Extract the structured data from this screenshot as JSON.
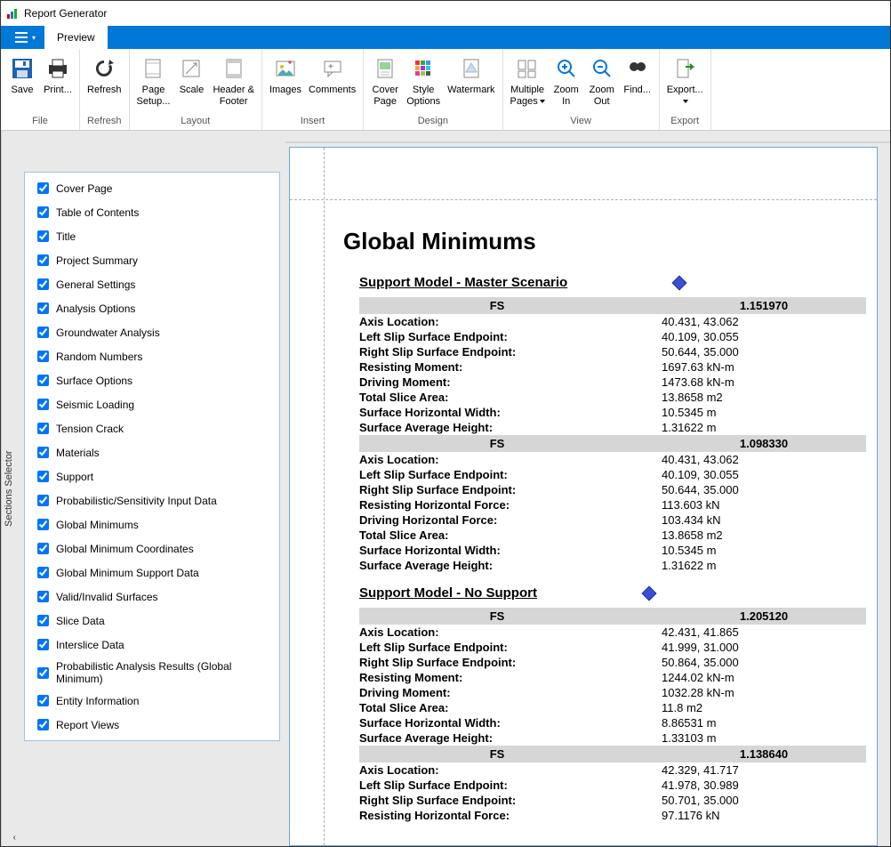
{
  "window": {
    "title": "Report Generator"
  },
  "tabs": {
    "preview": "Preview"
  },
  "ribbon": {
    "file": {
      "save": "Save",
      "print": "Print...",
      "group": "File"
    },
    "refresh": {
      "refresh": "Refresh",
      "group": "Refresh"
    },
    "layout": {
      "page_setup": "Page\nSetup...",
      "scale": "Scale",
      "header_footer": "Header &\nFooter",
      "group": "Layout"
    },
    "insert": {
      "images": "Images",
      "comments": "Comments",
      "group": "Insert"
    },
    "design": {
      "cover_page": "Cover\nPage",
      "style_options": "Style\nOptions",
      "watermark": "Watermark",
      "group": "Design"
    },
    "view": {
      "multiple_pages": "Multiple\nPages",
      "zoom_in": "Zoom\nIn",
      "zoom_out": "Zoom\nOut",
      "find": "Find...",
      "group": "View"
    },
    "export": {
      "export": "Export...",
      "group": "Export"
    }
  },
  "sidebar": {
    "title": "Sections Selector",
    "items": [
      "Cover Page",
      "Table of Contents",
      "Title",
      "Project Summary",
      "General Settings",
      "Analysis Options",
      "Groundwater Analysis",
      "Random Numbers",
      "Surface Options",
      "Seismic Loading",
      "Tension Crack",
      "Materials",
      "Support",
      "Probabilistic/Sensitivity Input Data",
      "Global Minimums",
      "Global Minimum Coordinates",
      "Global Minimum Support Data",
      "Valid/Invalid Surfaces",
      "Slice Data",
      "Interslice Data",
      "Probabilistic Analysis Results (Global Minimum)",
      "Entity Information",
      "Report Views"
    ]
  },
  "doc": {
    "heading": "Global Minimums",
    "section_a": "Support Model - Master Scenario",
    "section_b": "Support Model - No Support",
    "fs_label": "FS",
    "fs_values": [
      "1.151970",
      "1.098330",
      "1.205120",
      "1.138640"
    ],
    "labels": {
      "axis": "Axis Location:",
      "left_ep": "Left Slip Surface Endpoint:",
      "right_ep": "Right Slip Surface Endpoint:",
      "res_moment": "Resisting Moment:",
      "drv_moment": "Driving Moment:",
      "res_hforce": "Resisting Horizontal Force:",
      "drv_hforce": "Driving Horizontal Force:",
      "slice_area": "Total Slice Area:",
      "hwidth": "Surface Horizontal Width:",
      "aheight": "Surface Average Height:"
    },
    "blocks": [
      {
        "axis": "40.431, 43.062",
        "left": "40.109, 30.055",
        "right": "50.644, 35.000",
        "res_moment": "1697.63 kN-m",
        "drv_moment": "1473.68 kN-m",
        "area": "13.8658 m2",
        "hw": "10.5345 m",
        "ah": "1.31622 m"
      },
      {
        "axis": "40.431, 43.062",
        "left": "40.109, 30.055",
        "right": "50.644, 35.000",
        "res_hforce": "113.603 kN",
        "drv_hforce": "103.434 kN",
        "area": "13.8658 m2",
        "hw": "10.5345 m",
        "ah": "1.31622 m"
      },
      {
        "axis": "42.431, 41.865",
        "left": "41.999, 31.000",
        "right": "50.864, 35.000",
        "res_moment": "1244.02 kN-m",
        "drv_moment": "1032.28 kN-m",
        "area": "11.8 m2",
        "hw": "8.86531 m",
        "ah": "1.33103 m"
      },
      {
        "axis": "42.329, 41.717",
        "left": "41.978, 30.989",
        "right": "50.701, 35.000",
        "res_hforce": "97.1176 kN"
      }
    ]
  }
}
